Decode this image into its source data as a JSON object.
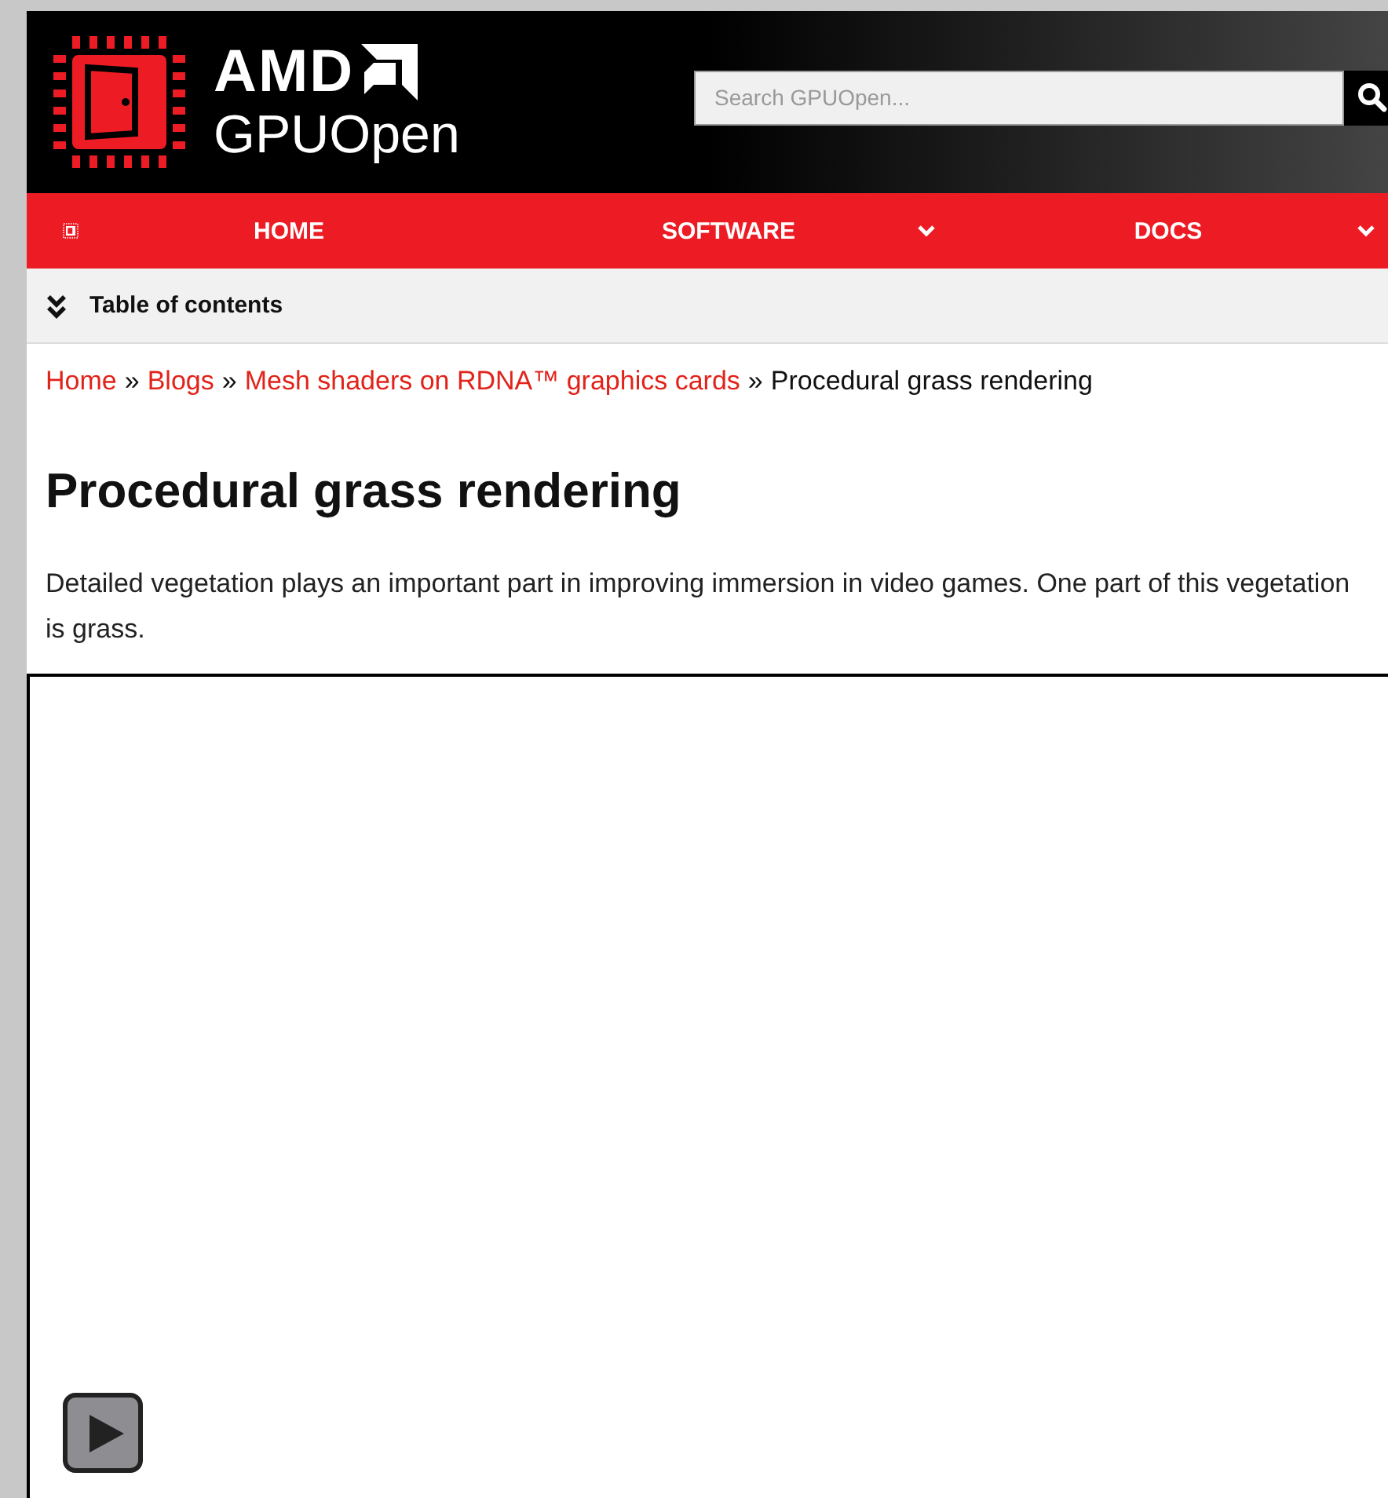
{
  "header": {
    "brand_top": "AMD",
    "brand_bottom": "GPUOpen",
    "search": {
      "placeholder": "Search GPUOpen..."
    }
  },
  "nav": {
    "items": [
      {
        "label": "HOME",
        "kind": "link"
      },
      {
        "label": "SOFTWARE",
        "kind": "dropdown"
      },
      {
        "label": "DOCS",
        "kind": "dropdown"
      }
    ]
  },
  "toc": {
    "label": "Table of contents"
  },
  "breadcrumb": {
    "separator": "»",
    "items": [
      {
        "label": "Home",
        "kind": "link"
      },
      {
        "label": "Blogs",
        "kind": "link"
      },
      {
        "label": "Mesh shaders on RDNA™ graphics cards",
        "kind": "link"
      },
      {
        "label": "Procedural grass rendering",
        "kind": "current"
      }
    ]
  },
  "article": {
    "title": "Procedural grass rendering",
    "intro": "Detailed vegetation plays an important part in improving immersion in video games. One part of this vegetation is grass."
  },
  "video": {
    "kind": "player"
  }
}
